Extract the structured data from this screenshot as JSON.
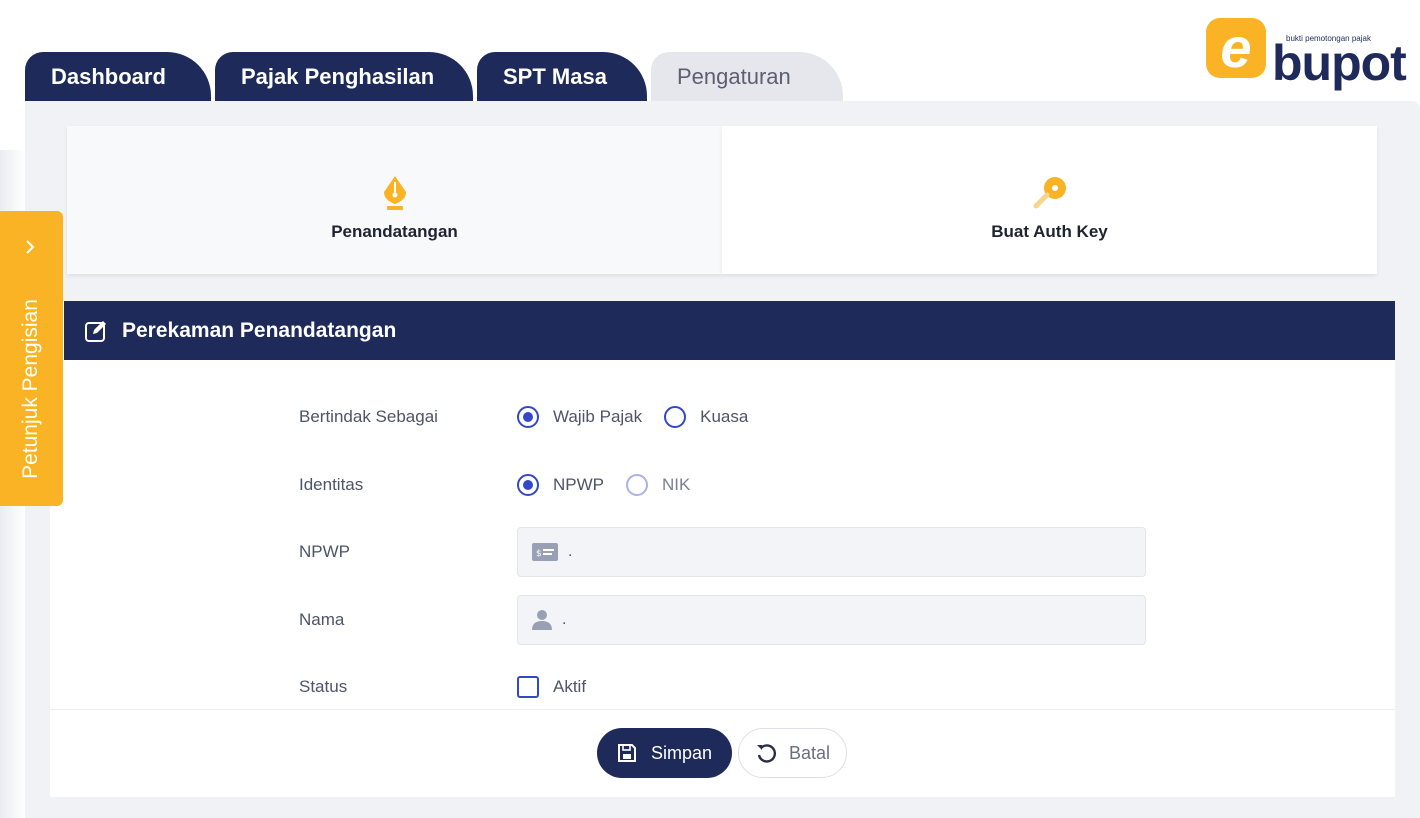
{
  "tabs": [
    {
      "label": "Dashboard",
      "active": false
    },
    {
      "label": "Pajak Penghasilan",
      "active": false
    },
    {
      "label": "SPT Masa",
      "active": false
    },
    {
      "label": "Pengaturan",
      "active": true
    }
  ],
  "logo": {
    "tagline": "bukti pemotongan pajak",
    "word": "bupot",
    "mark": "e"
  },
  "menu": [
    {
      "label": "Penandatangan",
      "icon": "pen-nib-icon"
    },
    {
      "label": "Buat Auth Key",
      "icon": "key-icon"
    }
  ],
  "help": {
    "label": "Petunjuk Pengisian"
  },
  "form": {
    "title": "Perekaman Penandatangan",
    "fields": {
      "bertindak": {
        "label": "Bertindak Sebagai",
        "options": [
          "Wajib Pajak",
          "Kuasa"
        ],
        "selected": "Wajib Pajak"
      },
      "identitas": {
        "label": "Identitas",
        "options": [
          "NPWP",
          "NIK"
        ],
        "selected": "NPWP"
      },
      "npwp": {
        "label": "NPWP",
        "value": "."
      },
      "nama": {
        "label": "Nama",
        "value": "."
      },
      "status": {
        "label": "Status",
        "option": "Aktif",
        "checked": false
      }
    },
    "buttons": {
      "save": "Simpan",
      "cancel": "Batal"
    }
  },
  "colors": {
    "navy": "#1e2a5a",
    "accent": "#f9b324",
    "radio": "#3348c9"
  }
}
